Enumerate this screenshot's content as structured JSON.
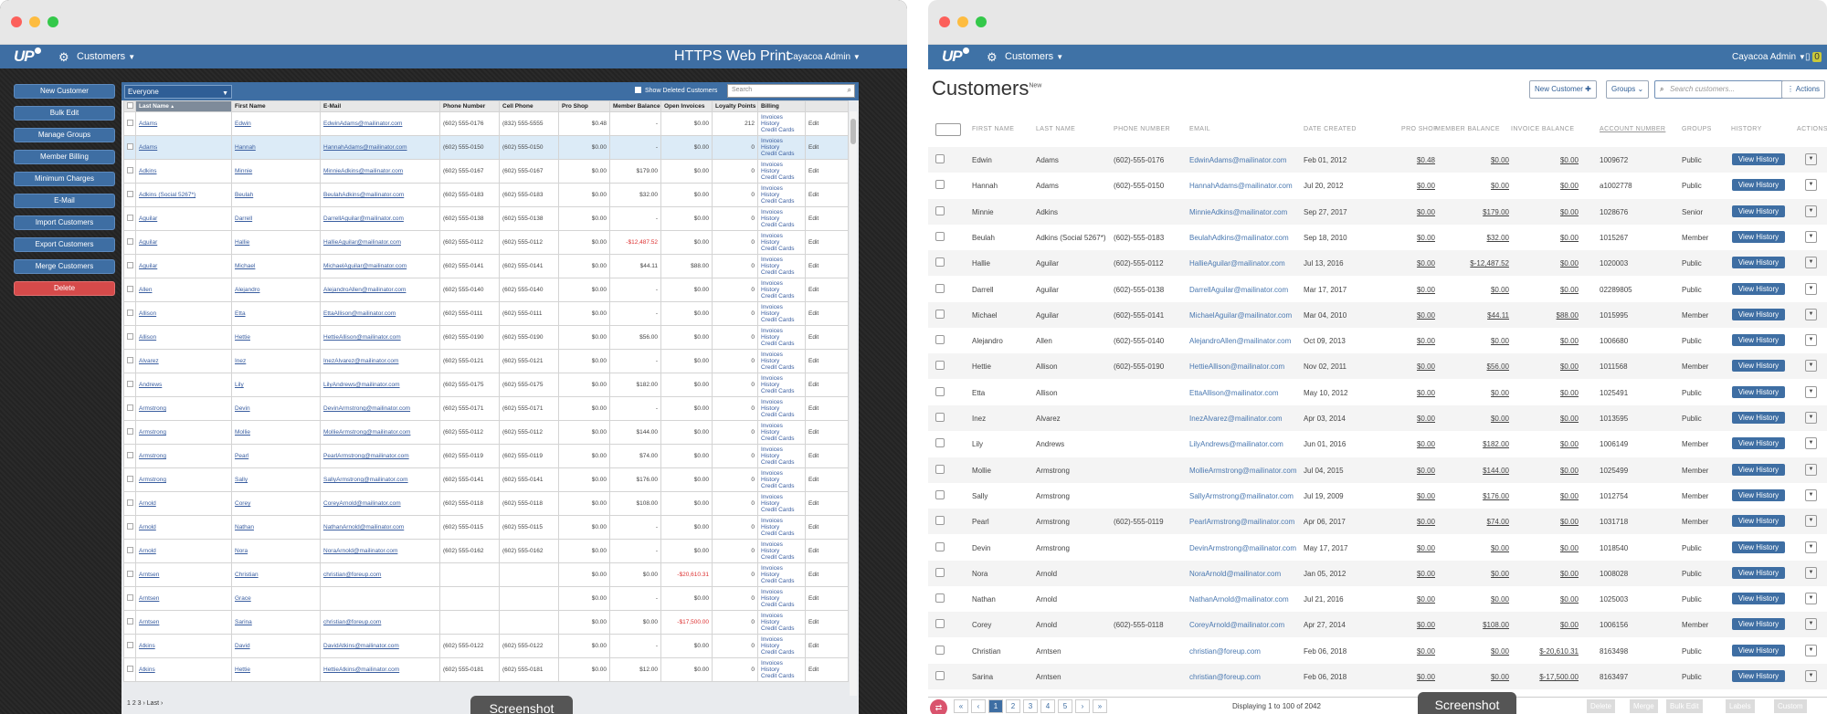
{
  "left": {
    "app_title": "HTTPS Web Print",
    "menu": "Customers",
    "user": "Cayacoa Admin",
    "side_buttons": [
      "New Customer",
      "Bulk Edit",
      "Manage Groups",
      "Member Billing",
      "Minimum Charges",
      "E-Mail",
      "Import Customers",
      "Export Customers",
      "Merge Customers",
      "Delete"
    ],
    "filter_select": "Everyone",
    "show_deleted": "Show Deleted Customers",
    "search_placeholder": "Search",
    "columns": [
      "Last Name",
      "First Name",
      "E-Mail",
      "Phone Number",
      "Cell Phone",
      "Pro Shop",
      "Member Balance",
      "Open Invoices",
      "Loyalty Points",
      "Billing",
      ""
    ],
    "billing_links": [
      "Invoices",
      "History",
      "Credit Cards"
    ],
    "edit": "Edit",
    "rows": [
      [
        "Adams",
        "Edwin",
        "EdwinAdams@mailinator.com",
        "(602) 555-0176",
        "(832) 555-5555",
        "$0.48",
        "-",
        "$0.00",
        "212"
      ],
      [
        "Adams",
        "Hannah",
        "HannahAdams@mailinator.com",
        "(602) 555-0150",
        "(602) 555-0150",
        "$0.00",
        "-",
        "$0.00",
        "0"
      ],
      [
        "Adkins",
        "Minnie",
        "MinnieAdkins@mailinator.com",
        "(602) 555-0167",
        "(602) 555-0167",
        "$0.00",
        "$179.00",
        "$0.00",
        "0"
      ],
      [
        "Adkins (Social 5267*)",
        "Beulah",
        "BeulahAdkins@mailinator.com",
        "(602) 555-0183",
        "(602) 555-0183",
        "$0.00",
        "$32.00",
        "$0.00",
        "0"
      ],
      [
        "Aguilar",
        "Darrell",
        "DarrellAguilar@mailinator.com",
        "(602) 555-0138",
        "(602) 555-0138",
        "$0.00",
        "-",
        "$0.00",
        "0"
      ],
      [
        "Aguilar",
        "Hallie",
        "HallieAguilar@mailinator.com",
        "(602) 555-0112",
        "(602) 555-0112",
        "$0.00",
        "-$12,487.52",
        "$0.00",
        "0"
      ],
      [
        "Aguilar",
        "Michael",
        "MichaelAguilar@mailinator.com",
        "(602) 555-0141",
        "(602) 555-0141",
        "$0.00",
        "$44.11",
        "$88.00",
        "0"
      ],
      [
        "Allen",
        "Alejandro",
        "AlejandroAllen@mailinator.com",
        "(602) 555-0140",
        "(602) 555-0140",
        "$0.00",
        "-",
        "$0.00",
        "0"
      ],
      [
        "Allison",
        "Etta",
        "EttaAllison@mailinator.com",
        "(602) 555-0111",
        "(602) 555-0111",
        "$0.00",
        "-",
        "$0.00",
        "0"
      ],
      [
        "Allison",
        "Hettie",
        "HettieAllison@mailinator.com",
        "(602) 555-0190",
        "(602) 555-0190",
        "$0.00",
        "$56.00",
        "$0.00",
        "0"
      ],
      [
        "Alvarez",
        "Inez",
        "InezAlvarez@mailinator.com",
        "(602) 555-0121",
        "(602) 555-0121",
        "$0.00",
        "-",
        "$0.00",
        "0"
      ],
      [
        "Andrews",
        "Lily",
        "LilyAndrews@mailinator.com",
        "(602) 555-0175",
        "(602) 555-0175",
        "$0.00",
        "$182.00",
        "$0.00",
        "0"
      ],
      [
        "Armstrong",
        "Devin",
        "DevinArmstrong@mailinator.com",
        "(602) 555-0171",
        "(602) 555-0171",
        "$0.00",
        "-",
        "$0.00",
        "0"
      ],
      [
        "Armstrong",
        "Mollie",
        "MollieArmstrong@mailinator.com",
        "(602) 555-0112",
        "(602) 555-0112",
        "$0.00",
        "$144.00",
        "$0.00",
        "0"
      ],
      [
        "Armstrong",
        "Pearl",
        "PearlArmstrong@mailinator.com",
        "(602) 555-0119",
        "(602) 555-0119",
        "$0.00",
        "$74.00",
        "$0.00",
        "0"
      ],
      [
        "Armstrong",
        "Sally",
        "SallyArmstrong@mailinator.com",
        "(602) 555-0141",
        "(602) 555-0141",
        "$0.00",
        "$176.00",
        "$0.00",
        "0"
      ],
      [
        "Arnold",
        "Corey",
        "CoreyArnold@mailinator.com",
        "(602) 555-0118",
        "(602) 555-0118",
        "$0.00",
        "$108.00",
        "$0.00",
        "0"
      ],
      [
        "Arnold",
        "Nathan",
        "NathanArnold@mailinator.com",
        "(602) 555-0115",
        "(602) 555-0115",
        "$0.00",
        "-",
        "$0.00",
        "0"
      ],
      [
        "Arnold",
        "Nora",
        "NoraArnold@mailinator.com",
        "(602) 555-0162",
        "(602) 555-0162",
        "$0.00",
        "-",
        "$0.00",
        "0"
      ],
      [
        "Arntsen",
        "Christian",
        "christian@foreup.com",
        "",
        "",
        "$0.00",
        "$0.00",
        "-$20,610.31",
        "0"
      ],
      [
        "Arntsen",
        "Grace",
        "",
        "",
        "",
        "$0.00",
        "-",
        "$0.00",
        "0"
      ],
      [
        "Arntsen",
        "Sarina",
        "christian@foreup.com",
        "",
        "",
        "$0.00",
        "$0.00",
        "-$17,500.00",
        "0"
      ],
      [
        "Atkins",
        "David",
        "DavidAtkins@mailinator.com",
        "(602) 555-0122",
        "(602) 555-0122",
        "$0.00",
        "-",
        "$0.00",
        "0"
      ],
      [
        "Atkins",
        "Hettie",
        "HettieAtkins@mailinator.com",
        "(602) 555-0181",
        "(602) 555-0181",
        "$0.00",
        "$12.00",
        "$0.00",
        "0"
      ]
    ],
    "pager": "1 2 3 › Last ›",
    "badge": "Screenshot"
  },
  "right": {
    "menu": "Customers",
    "user": "Cayacoa Admin",
    "notif": "0",
    "title": "Customers",
    "title_sup": "New",
    "new_customer": "New Customer ✚",
    "groups": "Groups ⌄",
    "search_placeholder": "Search customers...",
    "actions": "Actions",
    "columns": [
      "FIRST NAME",
      "LAST NAME",
      "PHONE NUMBER",
      "EMAIL",
      "DATE CREATED",
      "PRO SHOP",
      "MEMBER BALANCE",
      "INVOICE BALANCE",
      "ACCOUNT NUMBER",
      "GROUPS",
      "HISTORY",
      "ACTIONS"
    ],
    "view_history": "View History",
    "rows": [
      [
        "Edwin",
        "Adams",
        "(602)-555-0176",
        "EdwinAdams@mailinator.com",
        "Feb 01, 2012",
        "$0.48",
        "$0.00",
        "$0.00",
        "1009672",
        "Public"
      ],
      [
        "Hannah",
        "Adams",
        "(602)-555-0150",
        "HannahAdams@mailinator.com",
        "Jul 20, 2012",
        "$0.00",
        "$0.00",
        "$0.00",
        "a1002778",
        "Public"
      ],
      [
        "Minnie",
        "Adkins",
        "",
        "MinnieAdkins@mailinator.com",
        "Sep 27, 2017",
        "$0.00",
        "$179.00",
        "$0.00",
        "1028676",
        "Senior"
      ],
      [
        "Beulah",
        "Adkins (Social 5267*)",
        "(602)-555-0183",
        "BeulahAdkins@mailinator.com",
        "Sep 18, 2010",
        "$0.00",
        "$32.00",
        "$0.00",
        "1015267",
        "Member"
      ],
      [
        "Hallie",
        "Aguilar",
        "(602)-555-0112",
        "HallieAguilar@mailinator.com",
        "Jul 13, 2016",
        "$0.00",
        "$-12,487.52",
        "$0.00",
        "1020003",
        "Public"
      ],
      [
        "Darrell",
        "Aguilar",
        "(602)-555-0138",
        "DarrellAguilar@mailinator.com",
        "Mar 17, 2017",
        "$0.00",
        "$0.00",
        "$0.00",
        "02289805",
        "Public"
      ],
      [
        "Michael",
        "Aguilar",
        "(602)-555-0141",
        "MichaelAguilar@mailinator.com",
        "Mar 04, 2010",
        "$0.00",
        "$44.11",
        "$88.00",
        "1015995",
        "Member"
      ],
      [
        "Alejandro",
        "Allen",
        "(602)-555-0140",
        "AlejandroAllen@mailinator.com",
        "Oct 09, 2013",
        "$0.00",
        "$0.00",
        "$0.00",
        "1006680",
        "Public"
      ],
      [
        "Hettie",
        "Allison",
        "(602)-555-0190",
        "HettieAllison@mailinator.com",
        "Nov 02, 2011",
        "$0.00",
        "$56.00",
        "$0.00",
        "1011568",
        "Member"
      ],
      [
        "Etta",
        "Allison",
        "",
        "EttaAllison@mailinator.com",
        "May 10, 2012",
        "$0.00",
        "$0.00",
        "$0.00",
        "1025491",
        "Public"
      ],
      [
        "Inez",
        "Alvarez",
        "",
        "InezAlvarez@mailinator.com",
        "Apr 03, 2014",
        "$0.00",
        "$0.00",
        "$0.00",
        "1013595",
        "Public"
      ],
      [
        "Lily",
        "Andrews",
        "",
        "LilyAndrews@mailinator.com",
        "Jun 01, 2016",
        "$0.00",
        "$182.00",
        "$0.00",
        "1006149",
        "Member"
      ],
      [
        "Mollie",
        "Armstrong",
        "",
        "MollieArmstrong@mailinator.com",
        "Jul 04, 2015",
        "$0.00",
        "$144.00",
        "$0.00",
        "1025499",
        "Member"
      ],
      [
        "Sally",
        "Armstrong",
        "",
        "SallyArmstrong@mailinator.com",
        "Jul 19, 2009",
        "$0.00",
        "$176.00",
        "$0.00",
        "1012754",
        "Member"
      ],
      [
        "Pearl",
        "Armstrong",
        "(602)-555-0119",
        "PearlArmstrong@mailinator.com",
        "Apr 06, 2017",
        "$0.00",
        "$74.00",
        "$0.00",
        "1031718",
        "Member"
      ],
      [
        "Devin",
        "Armstrong",
        "",
        "DevinArmstrong@mailinator.com",
        "May 17, 2017",
        "$0.00",
        "$0.00",
        "$0.00",
        "1018540",
        "Public"
      ],
      [
        "Nora",
        "Arnold",
        "",
        "NoraArnold@mailinator.com",
        "Jan 05, 2012",
        "$0.00",
        "$0.00",
        "$0.00",
        "1008028",
        "Public"
      ],
      [
        "Nathan",
        "Arnold",
        "",
        "NathanArnold@mailinator.com",
        "Jul 21, 2016",
        "$0.00",
        "$0.00",
        "$0.00",
        "1025003",
        "Public"
      ],
      [
        "Corey",
        "Arnold",
        "(602)-555-0118",
        "CoreyArnold@mailinator.com",
        "Apr 27, 2014",
        "$0.00",
        "$108.00",
        "$0.00",
        "1006156",
        "Member"
      ],
      [
        "Christian",
        "Arntsen",
        "",
        "christian@foreup.com",
        "Feb 06, 2018",
        "$0.00",
        "$0.00",
        "$-20,610.31",
        "8163498",
        "Public"
      ],
      [
        "Sarina",
        "Arntsen",
        "",
        "christian@foreup.com",
        "Feb 06, 2018",
        "$0.00",
        "$0.00",
        "$-17,500.00",
        "8163497",
        "Public"
      ]
    ],
    "pages": [
      "«",
      "‹",
      "1",
      "2",
      "3",
      "4",
      "5",
      "›",
      "»"
    ],
    "displaying": "Displaying 1 to 100 of 2042",
    "bulk": [
      "Delete",
      "Merge",
      "Bulk Edit",
      "Labels",
      "Custom"
    ],
    "badge": "Screenshot"
  }
}
